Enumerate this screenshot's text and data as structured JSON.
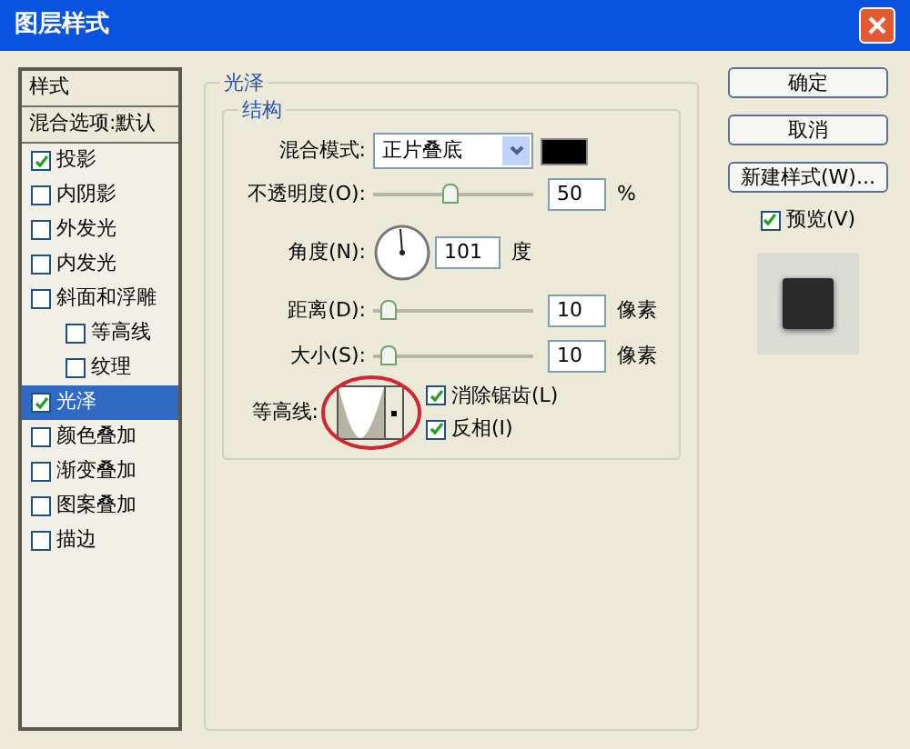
{
  "window": {
    "title": "图层样式"
  },
  "styles": [
    {
      "kind": "header",
      "label": "样式",
      "selected": false
    },
    {
      "kind": "header",
      "label": "混合选项:默认",
      "selected": false
    },
    {
      "kind": "check",
      "label": "投影",
      "checked": true,
      "selected": false
    },
    {
      "kind": "check",
      "label": "内阴影",
      "checked": false,
      "selected": false
    },
    {
      "kind": "check",
      "label": "外发光",
      "checked": false,
      "selected": false
    },
    {
      "kind": "check",
      "label": "内发光",
      "checked": false,
      "selected": false
    },
    {
      "kind": "check",
      "label": "斜面和浮雕",
      "checked": false,
      "selected": false,
      "children": [
        {
          "kind": "check",
          "label": "等高线",
          "checked": false,
          "selected": false
        },
        {
          "kind": "check",
          "label": "纹理",
          "checked": false,
          "selected": false
        }
      ]
    },
    {
      "kind": "check",
      "label": "光泽",
      "checked": true,
      "selected": true
    },
    {
      "kind": "check",
      "label": "颜色叠加",
      "checked": false,
      "selected": false
    },
    {
      "kind": "check",
      "label": "渐变叠加",
      "checked": false,
      "selected": false
    },
    {
      "kind": "check",
      "label": "图案叠加",
      "checked": false,
      "selected": false
    },
    {
      "kind": "check",
      "label": "描边",
      "checked": false,
      "selected": false
    }
  ],
  "panel": {
    "title": "光泽",
    "group": "结构",
    "blend_mode": {
      "label": "混合模式:",
      "value": "正片叠底"
    },
    "rows": [
      {
        "kind": "slider",
        "label": "不透明度(O):",
        "level": 0.48,
        "value": "50",
        "unit": "%"
      },
      {
        "kind": "dial",
        "label": "角度(N):",
        "value": "101",
        "unit": "度"
      },
      {
        "kind": "slider",
        "label": "距离(D):",
        "level": 0.05,
        "value": "10",
        "unit": "像素"
      },
      {
        "kind": "slider",
        "label": "大小(S):",
        "level": 0.05,
        "value": "10",
        "unit": "像素"
      }
    ],
    "contour": {
      "label": "等高线:",
      "options": [
        {
          "label": "消除锯齿(L)",
          "checked": true
        },
        {
          "label": "反相(I)",
          "checked": true
        }
      ]
    }
  },
  "buttons": [
    "确定",
    "取消",
    "新建样式(W)..."
  ],
  "preview": {
    "label": "预览(V)",
    "checked": true
  }
}
